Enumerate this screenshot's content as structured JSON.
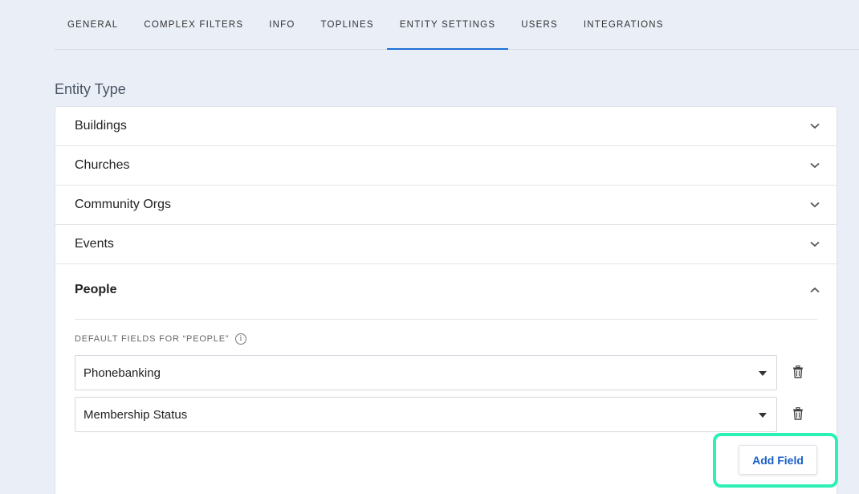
{
  "tabs": [
    {
      "label": "GENERAL"
    },
    {
      "label": "COMPLEX FILTERS"
    },
    {
      "label": "INFO"
    },
    {
      "label": "TOPLINES"
    },
    {
      "label": "ENTITY SETTINGS",
      "active": true
    },
    {
      "label": "USERS"
    },
    {
      "label": "INTEGRATIONS"
    }
  ],
  "section_title": "Entity Type",
  "entities": [
    {
      "label": "Buildings"
    },
    {
      "label": "Churches"
    },
    {
      "label": "Community Orgs"
    },
    {
      "label": "Events"
    }
  ],
  "people": {
    "label": "People",
    "defaults_label": "DEFAULT FIELDS FOR “PEOPLE”",
    "fields": [
      {
        "value": "Phonebanking"
      },
      {
        "value": "Membership Status"
      }
    ],
    "add_field_label": "Add Field"
  },
  "colors": {
    "accent": "#1f6fd6",
    "highlight": "#2ef0b7",
    "background": "#eaeef7"
  }
}
